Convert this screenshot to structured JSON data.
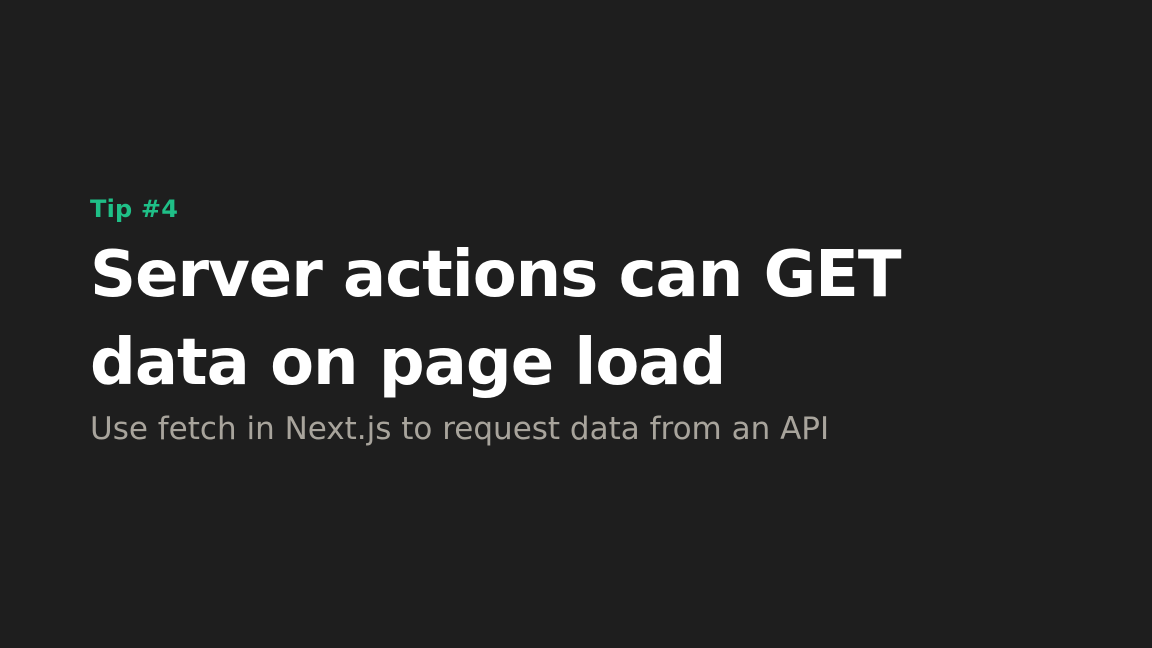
{
  "slide": {
    "tip_label": "Tip #4",
    "title_line1": "Server actions can GET",
    "title_line2": "data on page load",
    "subtitle": "Use fetch in Next.js to request data from an API"
  },
  "colors": {
    "background": "#1e1e1e",
    "accent": "#1fbf87",
    "title": "#ffffff",
    "subtitle": "#a8a49c"
  }
}
